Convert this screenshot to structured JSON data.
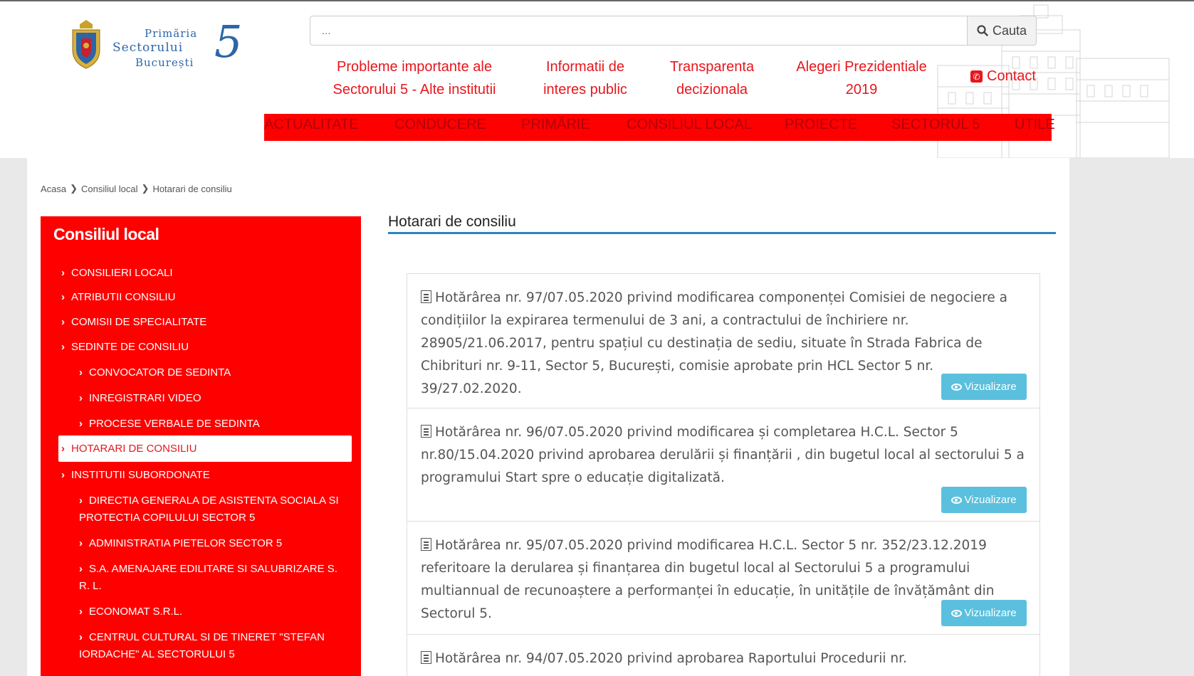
{
  "header": {
    "logo": {
      "line1": "Primăria",
      "line2": "Sectorului",
      "line3": "București",
      "number": "5"
    },
    "search": {
      "placeholder": "...",
      "button_label": "Cauta"
    },
    "quick_links": [
      {
        "line1": "Probleme importante ale",
        "line2": "Sectorului 5 - Alte institutii"
      },
      {
        "line1": "Informatii de",
        "line2": "interes public"
      },
      {
        "line1": "Transparenta",
        "line2": "decizionala"
      },
      {
        "line1": "Alegeri Prezidentiale",
        "line2": "2019"
      }
    ],
    "contact_label": "Contact"
  },
  "nav": {
    "items": [
      "ACTUALITATE",
      "CONDUCERE",
      "PRIMĂRIE",
      "CONSILIUL LOCAL",
      "PROIECTE",
      "SECTORUL 5",
      "UTILE"
    ]
  },
  "breadcrumb": [
    "Acasa",
    "Consiliul local",
    "Hotarari de consiliu"
  ],
  "sidebar": {
    "title": "Consiliul local",
    "items": [
      {
        "label": "CONSILIERI LOCALI"
      },
      {
        "label": "ATRIBUTII CONSILIU"
      },
      {
        "label": "COMISII DE SPECIALITATE"
      },
      {
        "label": "SEDINTE DE CONSILIU"
      },
      {
        "label": "CONVOCATOR DE SEDINTA"
      },
      {
        "label": "INREGISTRARI VIDEO"
      },
      {
        "label": "PROCESE VERBALE DE SEDINTA"
      },
      {
        "label": "HOTARARI DE CONSILIU"
      },
      {
        "label": "INSTITUTII SUBORDONATE"
      },
      {
        "line1": "DIRECTIA GENERALA DE ASISTENTA SOCIALA SI",
        "line2": "PROTECTIA COPILULUI SECTOR 5"
      },
      {
        "label": "ADMINISTRATIA PIETELOR SECTOR 5"
      },
      {
        "line1": "S.A. AMENAJARE EDILITARE SI SALUBRIZARE S.",
        "line2": "R. L."
      },
      {
        "label": "ECONOMAT S.R.L."
      },
      {
        "line1": "CENTRUL CULTURAL SI DE TINERET \"STEFAN",
        "line2": "IORDACHE\" AL SECTORULUI 5"
      }
    ]
  },
  "main": {
    "title": "Hotarari de consiliu",
    "view_label": "Vizualizare",
    "documents": [
      {
        "text": "Hotărârea nr. 97/07.05.2020 privind modificarea componenței Comisiei de negociere a condițiilor la expirarea termenului de 3 ani, a contractului de închiriere nr. 28905/21.06.2017, pentru spațiul cu destinația de sediu, situate în Strada Fabrica de Chibrituri nr. 9-11, Sector 5, București, comisie aprobate prin HCL Sector 5 nr. 39/27.02.2020."
      },
      {
        "text": "Hotărârea nr. 96/07.05.2020 privind modificarea și completarea H.C.L. Sector 5 nr.80/15.04.2020 privind aprobarea derulării și finanțării , din bugetul local al sectorului 5 a programului Start spre o educație digitalizată."
      },
      {
        "text": "Hotărârea nr. 95/07.05.2020 privind modificarea H.C.L. Sector 5 nr. 352/23.12.2019 referitoare la derularea și finanțarea din bugetul local al Sectorului 5 a programului multiannual de recunoaștere a performanței în educație, în unitățile de învățământ din Sectorul 5."
      },
      {
        "text": "Hotărârea nr. 94/07.05.2020 privind aprobarea Raportului Procedurii nr."
      }
    ]
  },
  "colors": {
    "accent_red": "#ff0000",
    "link_red": "#e8161c",
    "logo_blue": "#2c66a8",
    "rule_blue": "#2a83c5",
    "button_cyan": "#5bc0de"
  }
}
